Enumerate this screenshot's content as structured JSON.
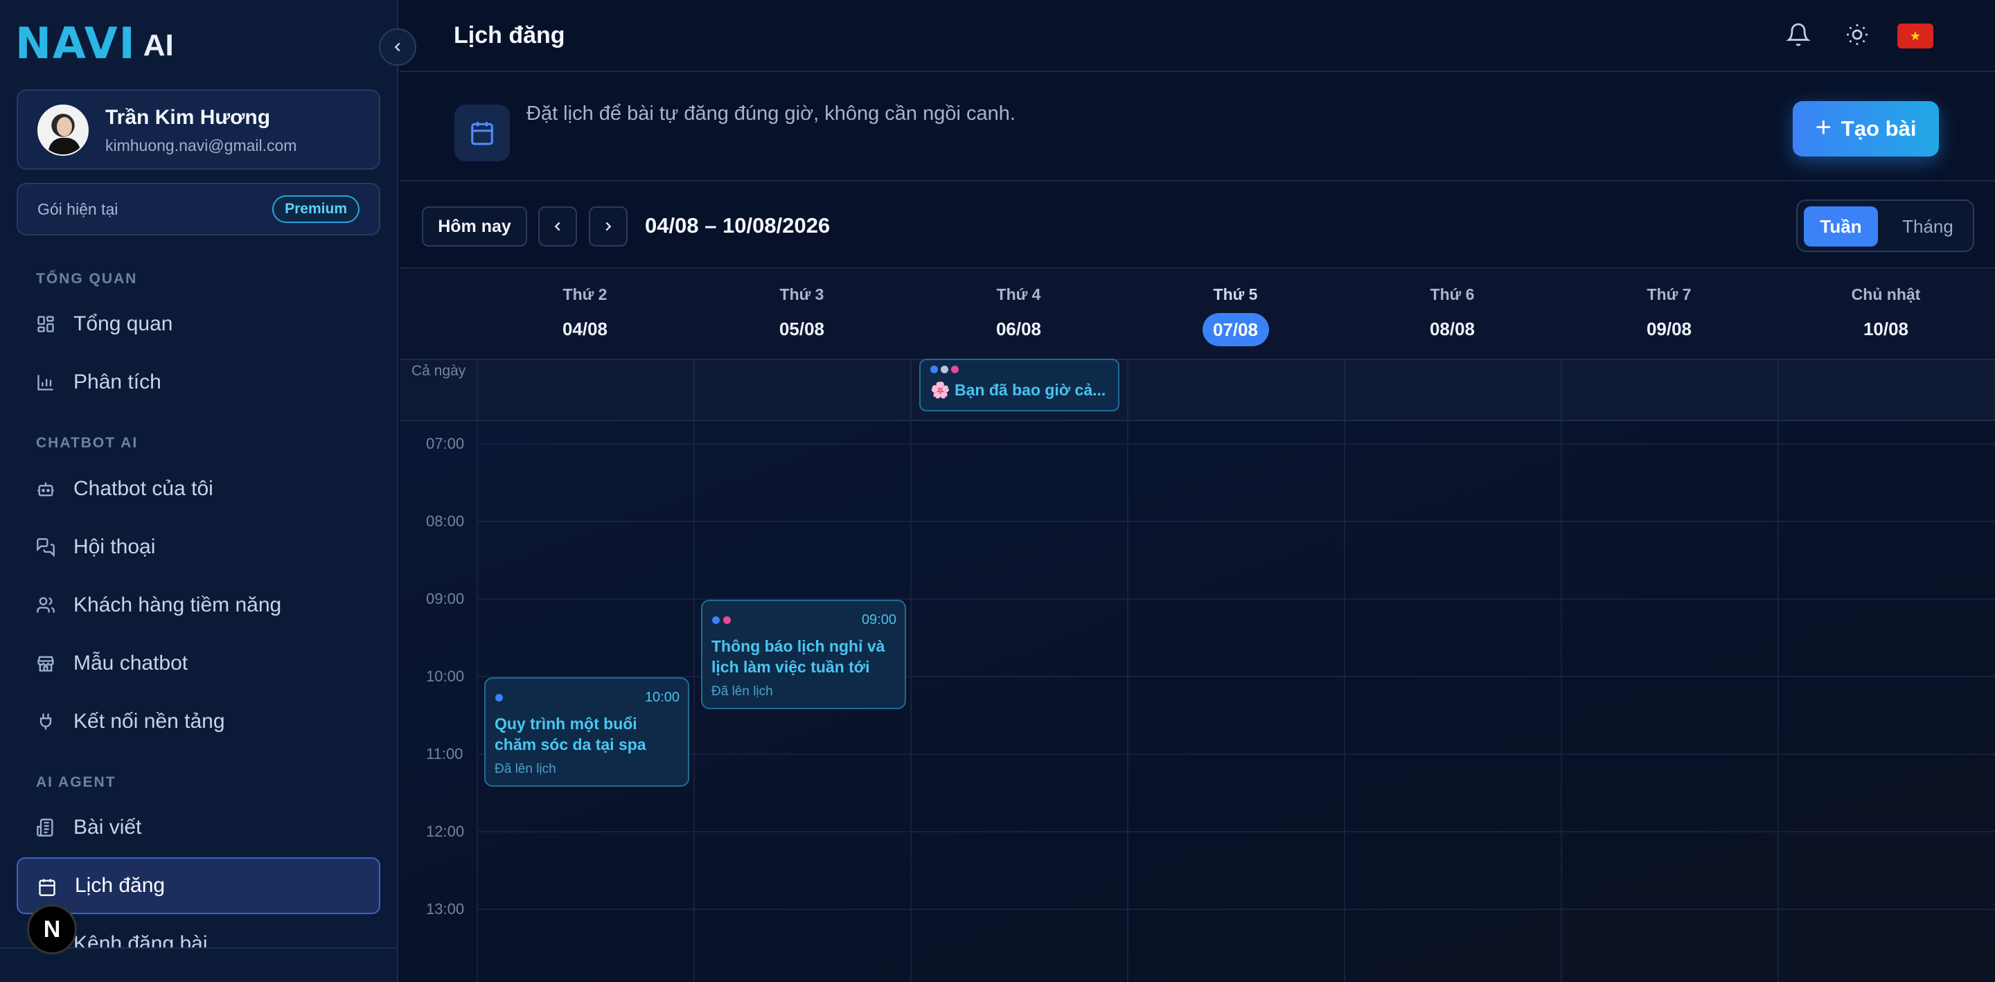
{
  "brand": {
    "logo_text": "NAVI",
    "logo_suffix": "AI"
  },
  "user": {
    "name": "Trần Kim Hương",
    "email": "kimhuong.navi@gmail.com"
  },
  "plan": {
    "label": "Gói hiện tại",
    "badge": "Premium"
  },
  "sidebar": {
    "sections": [
      {
        "title": "TỔNG QUAN"
      },
      {
        "title": "CHATBOT AI"
      },
      {
        "title": "AI AGENT"
      }
    ],
    "items": [
      {
        "label": "Tổng quan",
        "icon": "dashboard-icon"
      },
      {
        "label": "Phân tích",
        "icon": "chart-icon"
      },
      {
        "label": "Chatbot của tôi",
        "icon": "bot-icon"
      },
      {
        "label": "Hội thoại",
        "icon": "chat-icon"
      },
      {
        "label": "Khách hàng tiềm năng",
        "icon": "users-icon"
      },
      {
        "label": "Mẫu chatbot",
        "icon": "store-icon"
      },
      {
        "label": "Kết nối nền tảng",
        "icon": "plug-icon"
      },
      {
        "label": "Bài viết",
        "icon": "newspaper-icon"
      },
      {
        "label": "Lịch đăng",
        "icon": "calendar-icon",
        "active": true
      },
      {
        "label": "Kênh đăng bài",
        "icon": "channel-icon"
      }
    ],
    "next_badge": "N"
  },
  "header": {
    "title": "Lịch đăng",
    "flag": "★"
  },
  "banner": {
    "text": "Đặt lịch để bài tự đăng đúng giờ, không cần ngồi canh.",
    "create_button": "Tạo bài",
    "create_plus": "+"
  },
  "toolbar": {
    "today": "Hôm nay",
    "range": "04/08 – 10/08/2026",
    "views": {
      "week": "Tuần",
      "month": "Tháng"
    },
    "active_view": "week"
  },
  "calendar": {
    "days": [
      {
        "name": "Thứ 2",
        "date": "04/08"
      },
      {
        "name": "Thứ 3",
        "date": "05/08"
      },
      {
        "name": "Thứ 4",
        "date": "06/08"
      },
      {
        "name": "Thứ 5",
        "date": "07/08",
        "today": true
      },
      {
        "name": "Thứ 6",
        "date": "08/08"
      },
      {
        "name": "Thứ 7",
        "date": "09/08"
      },
      {
        "name": "Chủ nhật",
        "date": "10/08"
      }
    ],
    "allday_label": "Cả ngày",
    "allday_event": {
      "title": "🌸 Bạn đã bao giờ cả...",
      "day": "Thứ 4"
    },
    "hours": [
      "07:00",
      "08:00",
      "09:00",
      "10:00",
      "11:00",
      "12:00",
      "13:00"
    ],
    "events": [
      {
        "day": "Thứ 3",
        "time": "09:00",
        "title": "Thông báo lịch nghỉ và lịch làm việc tuần tới",
        "status": "Đã lên lịch"
      },
      {
        "day": "Thứ 2",
        "time": "10:00",
        "title": "Quy trình một buổi chăm sóc da tại spa",
        "status": "Đã lên lịch"
      }
    ]
  },
  "colors": {
    "accent": "#3b82f6",
    "event_text": "#49c7f1",
    "dot_blue": "#3b82f6",
    "dot_pink": "#ec4899",
    "dot_light": "#b8c4dc"
  }
}
